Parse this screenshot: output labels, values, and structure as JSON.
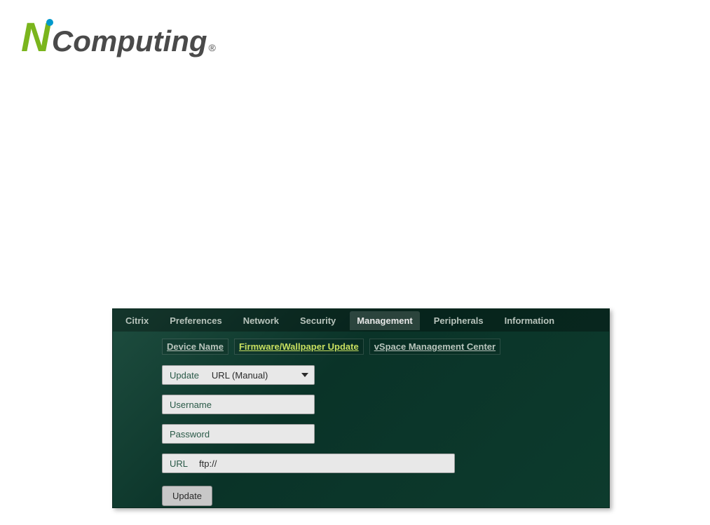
{
  "logo": {
    "part_n": "N",
    "part_rest": "Computing",
    "registered": "®"
  },
  "tabs": {
    "citrix": "Citrix",
    "preferences": "Preferences",
    "network": "Network",
    "security": "Security",
    "management": "Management",
    "peripherals": "Peripherals",
    "information": "Information"
  },
  "subtabs": {
    "device_name": "Device Name",
    "firmware_update": "Firmware/Wallpaper Update",
    "vspace": "vSpace Management Center"
  },
  "form": {
    "update_label": "Update",
    "update_method": "URL (Manual)",
    "username_label": "Username",
    "username_value": "",
    "password_label": "Password",
    "password_value": "",
    "url_label": "URL",
    "url_value": "ftp://",
    "update_button": "Update"
  }
}
